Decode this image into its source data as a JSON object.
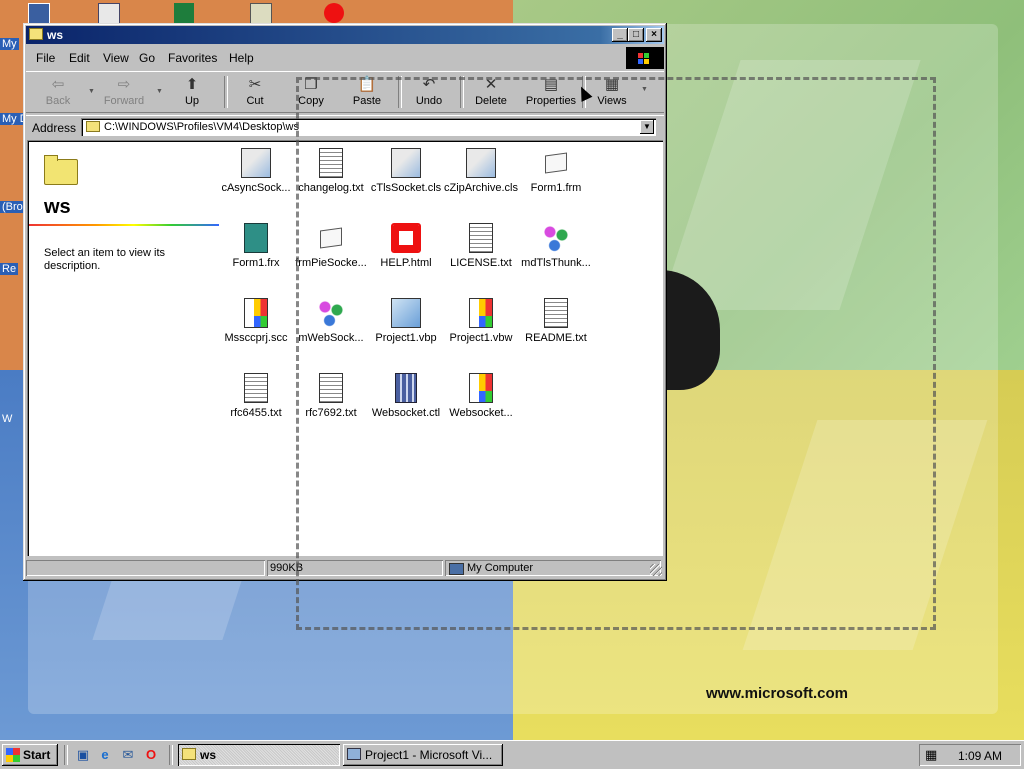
{
  "desktop": {
    "labels": [
      "My",
      "My D",
      "(Bro",
      "Re",
      "W"
    ],
    "wallpaper_text": "www.microsoft.com"
  },
  "window": {
    "title": "ws",
    "menu": [
      "File",
      "Edit",
      "View",
      "Go",
      "Favorites",
      "Help"
    ],
    "toolbar": {
      "back": "Back",
      "forward": "Forward",
      "up": "Up",
      "cut": "Cut",
      "copy": "Copy",
      "paste": "Paste",
      "undo": "Undo",
      "delete": "Delete",
      "properties": "Properties",
      "views": "Views"
    },
    "address": {
      "label": "Address",
      "value": "C:\\WINDOWS\\Profiles\\VM4\\Desktop\\ws"
    },
    "side_panel": {
      "title": "ws",
      "description": "Select an item to view its description."
    },
    "files": [
      {
        "name": "cAsyncSock...",
        "icon": "vb-class-icon"
      },
      {
        "name": "changelog.txt",
        "icon": "text-file-icon"
      },
      {
        "name": "cTlsSocket.cls",
        "icon": "vb-class-icon"
      },
      {
        "name": "cZipArchive.cls",
        "icon": "vb-class-icon"
      },
      {
        "name": "Form1.frm",
        "icon": "vb-form-icon"
      },
      {
        "name": "Form1.frx",
        "icon": "binary-file-icon"
      },
      {
        "name": "frmPieSocke...",
        "icon": "vb-form-icon"
      },
      {
        "name": "HELP.html",
        "icon": "opera-html-icon"
      },
      {
        "name": "LICENSE.txt",
        "icon": "text-file-icon"
      },
      {
        "name": "mdTlsThunk...",
        "icon": "vb-module-icon"
      },
      {
        "name": "Mssccprj.scc",
        "icon": "windows-file-icon"
      },
      {
        "name": "mWebSock...",
        "icon": "vb-module-icon"
      },
      {
        "name": "Project1.vbp",
        "icon": "vb-project-icon"
      },
      {
        "name": "Project1.vbw",
        "icon": "windows-file-icon"
      },
      {
        "name": "README.txt",
        "icon": "text-file-icon"
      },
      {
        "name": "rfc6455.txt",
        "icon": "text-file-icon"
      },
      {
        "name": "rfc7692.txt",
        "icon": "text-file-icon"
      },
      {
        "name": "Websocket.ctl",
        "icon": "vb-usercontrol-icon"
      },
      {
        "name": "Websocket...",
        "icon": "windows-file-icon"
      }
    ],
    "status": {
      "size": "990KB",
      "zone": "My Computer"
    }
  },
  "taskbar": {
    "start": "Start",
    "tasks": [
      {
        "label": "ws",
        "active": true
      },
      {
        "label": "Project1 - Microsoft Vi...",
        "active": false
      }
    ],
    "clock": "1:09 AM"
  }
}
